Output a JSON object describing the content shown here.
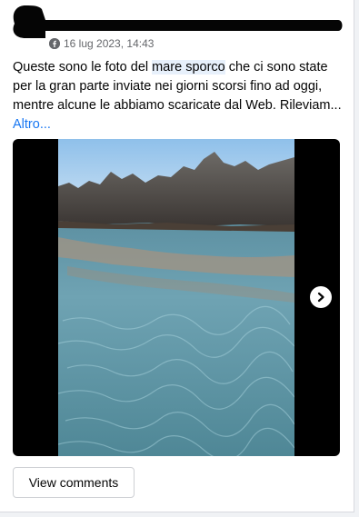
{
  "post": {
    "date": "16 lug 2023, 14:43",
    "text_before": "Queste sono le foto del ",
    "text_highlight": "mare sporco",
    "text_after": " che ci sono state per la gran parte inviate nei giorni scorsi fino ad oggi, mentre alcune le abbiamo scaricate dal Web. Rileviam... ",
    "more_label": "Altro..."
  },
  "media": {
    "next_icon": "chevron-right-icon"
  },
  "actions": {
    "view_comments_label": "View comments"
  },
  "colors": {
    "link": "#1877f2",
    "meta": "#65676b",
    "highlight": "#e7f0fb"
  }
}
